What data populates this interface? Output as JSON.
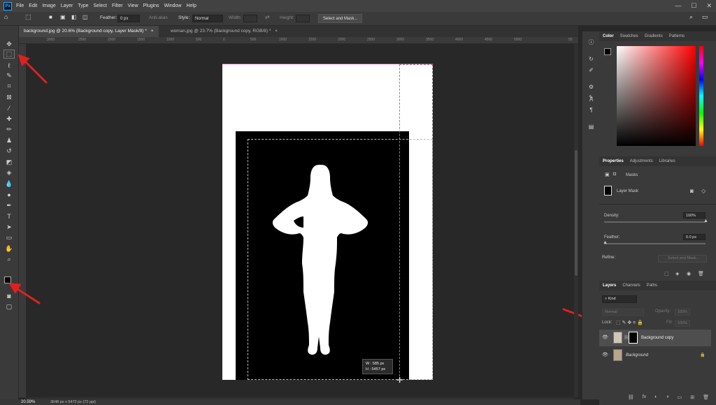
{
  "menubar": {
    "logo": "Ps",
    "items": [
      "File",
      "Edit",
      "Image",
      "Layer",
      "Type",
      "Select",
      "Filter",
      "View",
      "Plugins",
      "Window",
      "Help"
    ],
    "window_controls": [
      "—",
      "☐",
      "✕"
    ]
  },
  "options": {
    "feather_label": "Feather:",
    "feather_value": "0 px",
    "antialias_label": "Anti-alias",
    "style_label": "Style:",
    "style_value": "Normal",
    "width_label": "Width:",
    "height_label": "Height:",
    "select_mask_label": "Select and Mask..."
  },
  "tabs": [
    {
      "label": "background.jpg @ 20.6% (Background copy, Layer Mask/8) *",
      "close": "×"
    },
    {
      "label": "woman.jpg @ 23.7% (Background copy, RGB/8) *",
      "close": "×"
    }
  ],
  "ruler": [
    "3000",
    "2500",
    "2000",
    "1500",
    "1000",
    "500",
    "0",
    "500",
    "1000",
    "1500",
    "2000",
    "2500",
    "3000",
    "3500",
    "4000",
    "4500",
    "5000",
    "55"
  ],
  "size_info": {
    "w": "W :   585 px",
    "h": "H :  5457 px"
  },
  "status": {
    "zoom": "20.59%",
    "doc": "3648 px x 5472 px (72 ppi)"
  },
  "color_panel": {
    "tabs": [
      "Color",
      "Swatches",
      "Gradients",
      "Patterns"
    ]
  },
  "properties": {
    "tabs": [
      "Properties",
      "Adjustments",
      "Libraries"
    ],
    "masks_label": "Masks",
    "layer_mask_label": "Layer Mask",
    "density_label": "Density:",
    "density_value": "100%",
    "feather_label": "Feather:",
    "feather_value": "0.0 px",
    "refine_label": "Refine:",
    "select_mask_label": "Select and Mask..."
  },
  "layers": {
    "tabs": [
      "Layers",
      "Channels",
      "Paths"
    ],
    "kind_label": "Kind",
    "blend_value": "Normal",
    "opacity_label": "Opacity:",
    "opacity_value": "100%",
    "lock_label": "Lock:",
    "fill_label": "Fill:",
    "fill_value": "100%",
    "rows": [
      {
        "name": "Background copy"
      },
      {
        "name": "Background"
      }
    ],
    "bottom_icons": [
      "⛓",
      "fx",
      "◐",
      "◑",
      "▭",
      "⊞",
      "🗑"
    ]
  },
  "colors": {
    "accent": "#e02020",
    "panel": "#3a3a3a",
    "canvas_bg": "#282828"
  }
}
